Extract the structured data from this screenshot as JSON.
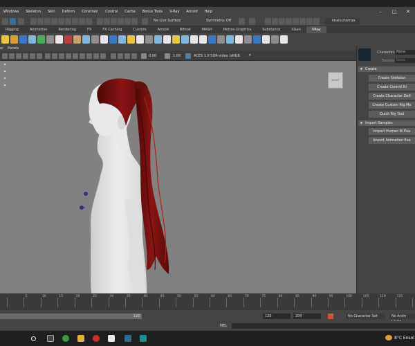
{
  "menubar": {
    "items": [
      "Windows",
      "Skeleton",
      "Skin",
      "Deform",
      "Constrain",
      "Control",
      "Cache",
      "Bonus Tools",
      "V-Ray",
      "Arnold",
      "Help"
    ]
  },
  "statusline": {
    "live_surface": "No Live Surface",
    "symmetry": "Symmetry: Off",
    "user": "khalouhamza"
  },
  "shelf_tabs": [
    "Rigging",
    "Animation",
    "Rendering",
    "FX",
    "FX Caching",
    "Custom",
    "Arnold",
    "Bifrost",
    "MASH",
    "Motion Graphics",
    "Substance",
    "XGen",
    "VRay"
  ],
  "shelf_icons": [
    "yellow",
    "gold",
    "blue",
    "lightblue",
    "green",
    "grey",
    "white",
    "red",
    "tan",
    "lightblue",
    "grey",
    "white",
    "blue",
    "lightblue",
    "yellow",
    "white",
    "grey",
    "lightblue",
    "white",
    "yellow",
    "lightblue",
    "white",
    "white",
    "blue",
    "grey",
    "lightblue",
    "white",
    "grey",
    "blue",
    "white",
    "grey",
    "white"
  ],
  "viewport_menu": {
    "items": [
      "er",
      "Panels"
    ]
  },
  "viewport_toolbar": {
    "exposure": "0.00",
    "gamma": "1.00",
    "color_space": "ACES 1.0 SDR-video (sRGB"
  },
  "viewcube": {
    "label": "RIGHT"
  },
  "character_panel": {
    "character_label": "Character:",
    "character_value": "None",
    "source_label": "Source:",
    "source_value": "None",
    "create_section": "Create",
    "create_buttons": [
      "Create Skeleton",
      "Create Control Ri",
      "Create Character Defi",
      "Create Custom Rig Ma",
      "Quick Rig Tool"
    ],
    "import_section": "Import Samples",
    "import_buttons": [
      "Import Human IK Exa",
      "Import Animation Exa"
    ]
  },
  "timeline": {
    "labels": [
      "5",
      "10",
      "15",
      "20",
      "25",
      "30",
      "35",
      "40",
      "45",
      "50",
      "55",
      "60",
      "65",
      "70",
      "75",
      "80",
      "85",
      "90",
      "95",
      "100",
      "105",
      "110",
      "115"
    ]
  },
  "range": {
    "slider_end": "120",
    "end_time": "120",
    "total_time": "200",
    "character_set": "No Character Set",
    "anim_layer": "No Anim Layer"
  },
  "cmdline": {
    "label": "MEL"
  },
  "taskbar": {
    "weather": "8°C  Ensol"
  },
  "colors": {
    "hair": "#7a1010",
    "body": "#e4e4e4",
    "viewport_bg": "#818181",
    "panel_bg": "#444444"
  }
}
